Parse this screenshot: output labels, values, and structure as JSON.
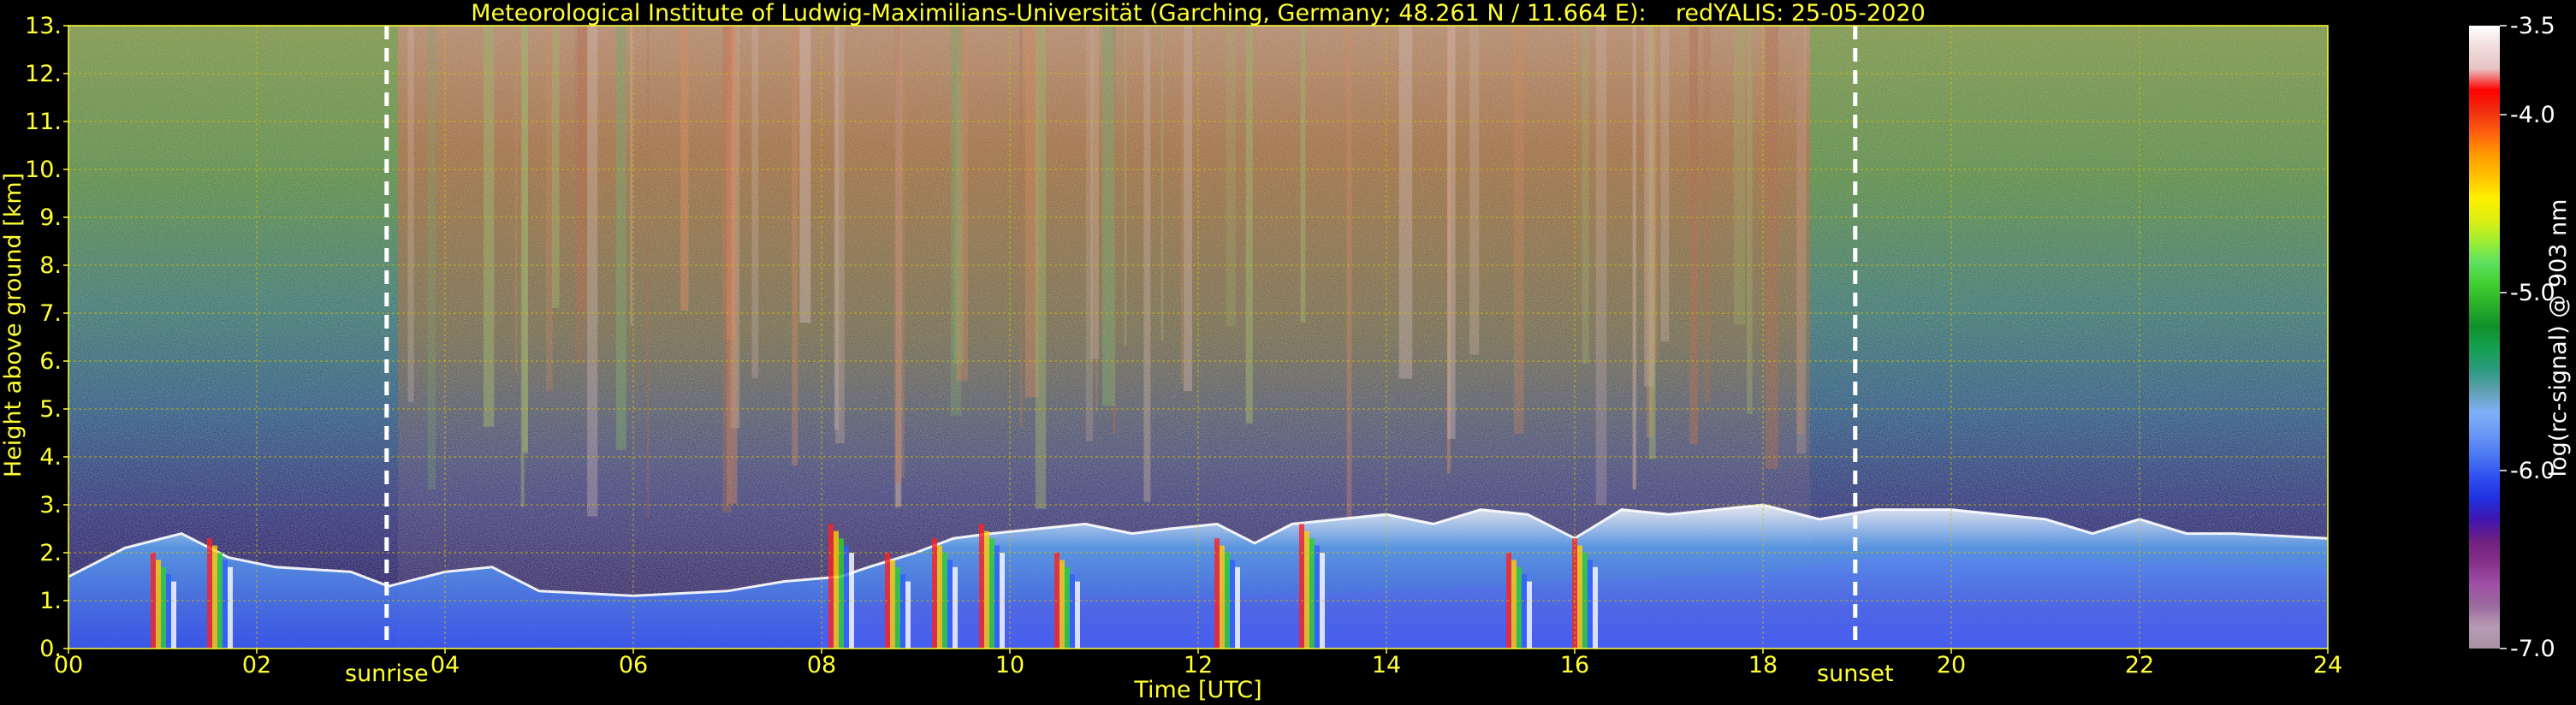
{
  "chart_data": {
    "type": "heatmap",
    "title": "Meteorological Institute of Ludwig-Maximilians-Universität (Garching, Germany; 48.261 N / 11.664 E):    redYALIS: 25-05-2020",
    "xlabel": "Time [UTC]",
    "ylabel": "Height above ground [km]",
    "xlim": [
      0,
      24
    ],
    "ylim": [
      0,
      13
    ],
    "x_ticks": [
      "00",
      "02",
      "04",
      "06",
      "08",
      "10",
      "12",
      "14",
      "16",
      "18",
      "20",
      "22",
      "24"
    ],
    "y_ticks": [
      "0.",
      "1.",
      "2.",
      "3.",
      "4.",
      "5.",
      "6.",
      "7.",
      "8.",
      "9.",
      "10.",
      "11.",
      "12.",
      "13."
    ],
    "grid": true,
    "annotations": [
      {
        "label": "sunrise",
        "x": 3.38
      },
      {
        "label": "sunset",
        "x": 18.98
      }
    ],
    "colorbar": {
      "label": "log(rc-signal) @ 903 nm",
      "range": [
        -7.0,
        -3.5
      ],
      "ticks": [
        "-3.5",
        "-4.0",
        "-5.0",
        "-6.0",
        "-7.0"
      ],
      "colors": [
        "#a892a4",
        "#b89bb4",
        "#9a6a9e",
        "#a04fa5",
        "#85318a",
        "#702080",
        "#4015b0",
        "#2030e0",
        "#3050f0",
        "#4a78f0",
        "#6a98f5",
        "#80b0f8",
        "#60a0b0",
        "#2a9a80",
        "#15a050",
        "#10902a",
        "#2ab02a",
        "#40d030",
        "#60e060",
        "#a0ee30",
        "#e0ee10",
        "#fff000",
        "#ffc000",
        "#ff9a00",
        "#ff6010",
        "#f03010",
        "#ff0000",
        "#e8c4c4",
        "#f0dcdc",
        "#ffffff"
      ]
    },
    "structures": {
      "aerosol_layer_top_km": [
        [
          0.0,
          1.5
        ],
        [
          0.6,
          2.1
        ],
        [
          1.2,
          2.4
        ],
        [
          1.7,
          1.9
        ],
        [
          2.2,
          1.7
        ],
        [
          3.0,
          1.6
        ],
        [
          3.4,
          1.3
        ],
        [
          4.0,
          1.6
        ],
        [
          4.5,
          1.7
        ],
        [
          5.0,
          1.2
        ],
        [
          6.0,
          1.1
        ],
        [
          7.0,
          1.2
        ],
        [
          7.6,
          1.4
        ],
        [
          8.2,
          1.5
        ],
        [
          8.5,
          1.7
        ],
        [
          9.0,
          2.0
        ],
        [
          9.4,
          2.3
        ],
        [
          9.8,
          2.4
        ],
        [
          10.3,
          2.5
        ],
        [
          10.8,
          2.6
        ],
        [
          11.3,
          2.4
        ],
        [
          11.7,
          2.5
        ],
        [
          12.2,
          2.6
        ],
        [
          12.6,
          2.2
        ],
        [
          13.0,
          2.6
        ],
        [
          13.5,
          2.7
        ],
        [
          14.0,
          2.8
        ],
        [
          14.5,
          2.6
        ],
        [
          15.0,
          2.9
        ],
        [
          15.5,
          2.8
        ],
        [
          16.0,
          2.3
        ],
        [
          16.5,
          2.9
        ],
        [
          17.0,
          2.8
        ],
        [
          17.5,
          2.9
        ],
        [
          18.0,
          3.0
        ],
        [
          18.6,
          2.7
        ],
        [
          19.2,
          2.9
        ],
        [
          20.0,
          2.9
        ],
        [
          21.0,
          2.7
        ],
        [
          21.5,
          2.4
        ],
        [
          22.0,
          2.7
        ],
        [
          22.5,
          2.4
        ],
        [
          23.0,
          2.4
        ],
        [
          24.0,
          2.3
        ]
      ],
      "convective_cells_x": [
        1.0,
        1.6,
        8.2,
        8.8,
        9.3,
        9.8,
        10.6,
        12.3,
        13.2,
        15.4,
        16.1
      ],
      "upper_noise_strong_windows": [
        [
          3.5,
          18.5
        ]
      ]
    }
  }
}
